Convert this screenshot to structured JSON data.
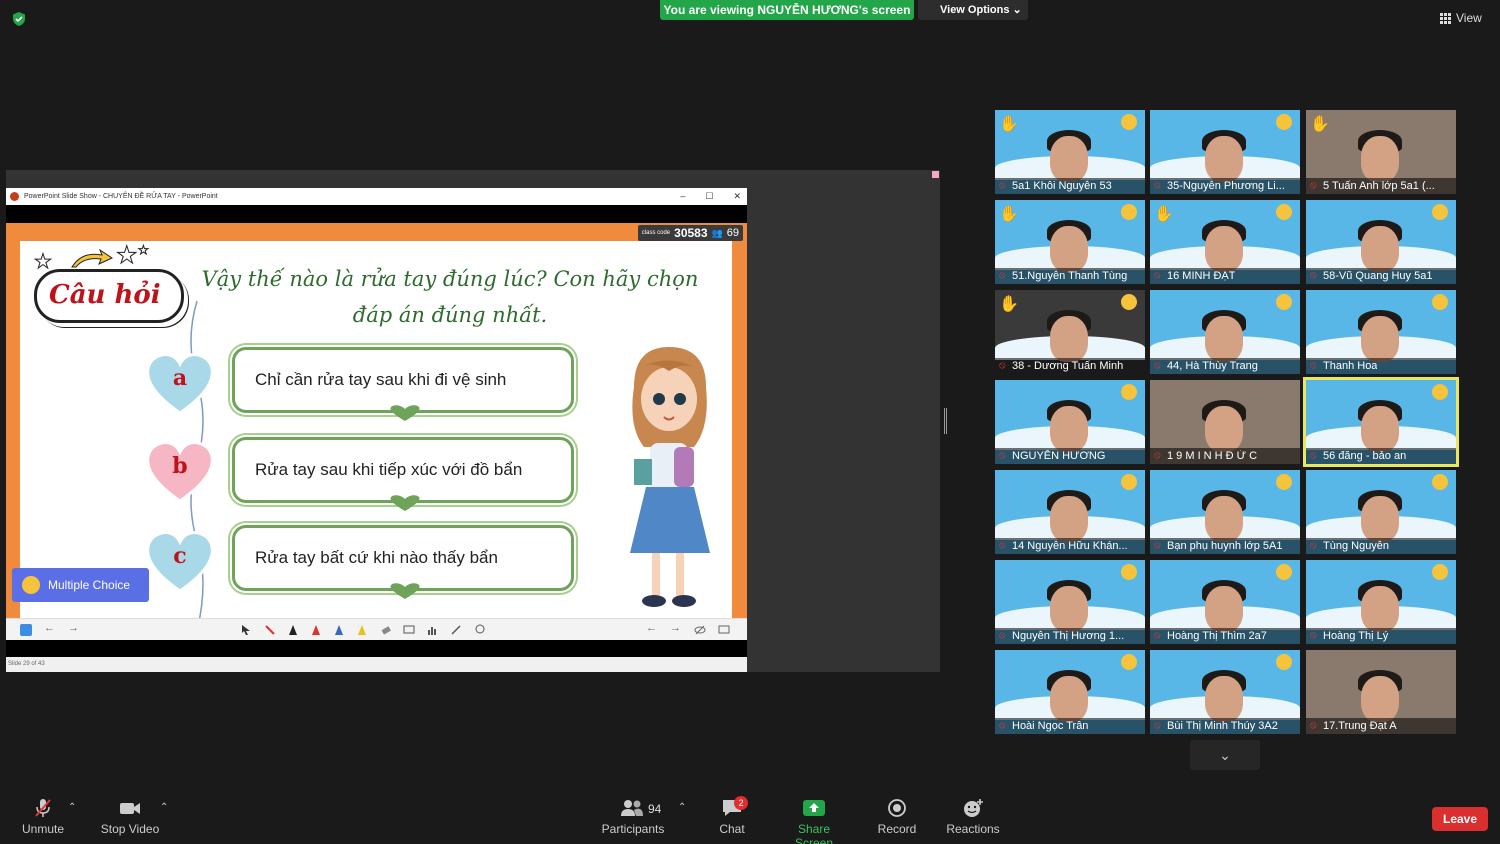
{
  "top": {
    "viewing_banner": "You are viewing NGUYỄN HƯƠNG's screen",
    "view_options": "View Options",
    "view": "View"
  },
  "ppt": {
    "window_title": "PowerPoint Slide Show  -  CHUYÊN ĐỀ RỬA TAY  -  PowerPoint",
    "class_code_label": "class code",
    "class_code": "30583",
    "participants_count": "69",
    "header_badge": "Câu hỏi",
    "question_line1": "Vậy thế nào là rửa tay đúng lúc? Con hãy chọn",
    "question_line2": "đáp án đúng nhất.",
    "answers": [
      {
        "letter": "a",
        "text": "Chỉ cần rửa tay sau khi đi vệ sinh"
      },
      {
        "letter": "b",
        "text": "Rửa tay sau khi tiếp xúc với đồ bẩn"
      },
      {
        "letter": "c",
        "text": "Rửa tay bất cứ khi nào thấy bẩn"
      }
    ],
    "multiple_choice": "Multiple Choice",
    "slide_status": "Slide 29 of 43"
  },
  "participants": [
    {
      "name": "5a1 Khôi Nguyễn 53",
      "hand": true
    },
    {
      "name": "35-Nguyễn Phương Li...",
      "hand": false
    },
    {
      "name": "5 Tuấn Anh lớp 5a1 (...",
      "hand": true
    },
    {
      "name": "51.Nguyễn Thanh Tùng",
      "hand": true
    },
    {
      "name": "16 MINH ĐẠT",
      "hand": true
    },
    {
      "name": "58-Vũ Quang Huy 5a1",
      "hand": false
    },
    {
      "name": "38 - Dương Tuấn Minh",
      "hand": true
    },
    {
      "name": "44, Hà Thùy Trang",
      "hand": false
    },
    {
      "name": "Thanh Hoa",
      "hand": false
    },
    {
      "name": "NGUYỄN HƯƠNG",
      "hand": false
    },
    {
      "name": "1 9 M I N H Đ Ứ C",
      "hand": false
    },
    {
      "name": "56 đăng - bảo an",
      "hand": false
    },
    {
      "name": "14 Nguyễn Hữu Khán...",
      "hand": false
    },
    {
      "name": "Bạn phụ huynh lớp 5A1",
      "hand": false
    },
    {
      "name": "Tùng Nguyễn",
      "hand": false
    },
    {
      "name": "Nguyễn Thị Hương 1...",
      "hand": false
    },
    {
      "name": "Hoàng Thị Thìm 2a7",
      "hand": false
    },
    {
      "name": "Hoàng Thị Lý",
      "hand": false
    },
    {
      "name": "Hoài Ngọc Trân",
      "hand": false
    },
    {
      "name": "Bùi Thị Minh Thúy 3A2",
      "hand": false
    },
    {
      "name": "17.Trung Đạt A",
      "hand": false
    }
  ],
  "toolbar": {
    "unmute": "Unmute",
    "stop_video": "Stop Video",
    "participants": "Participants",
    "participants_count": "94",
    "chat": "Chat",
    "chat_badge": "2",
    "share_screen": "Share Screen",
    "record": "Record",
    "reactions": "Reactions",
    "leave": "Leave"
  },
  "colors": {
    "share_green": "#23a54a",
    "leave_red": "#d9302f",
    "slide_orange": "#f08a3c"
  }
}
